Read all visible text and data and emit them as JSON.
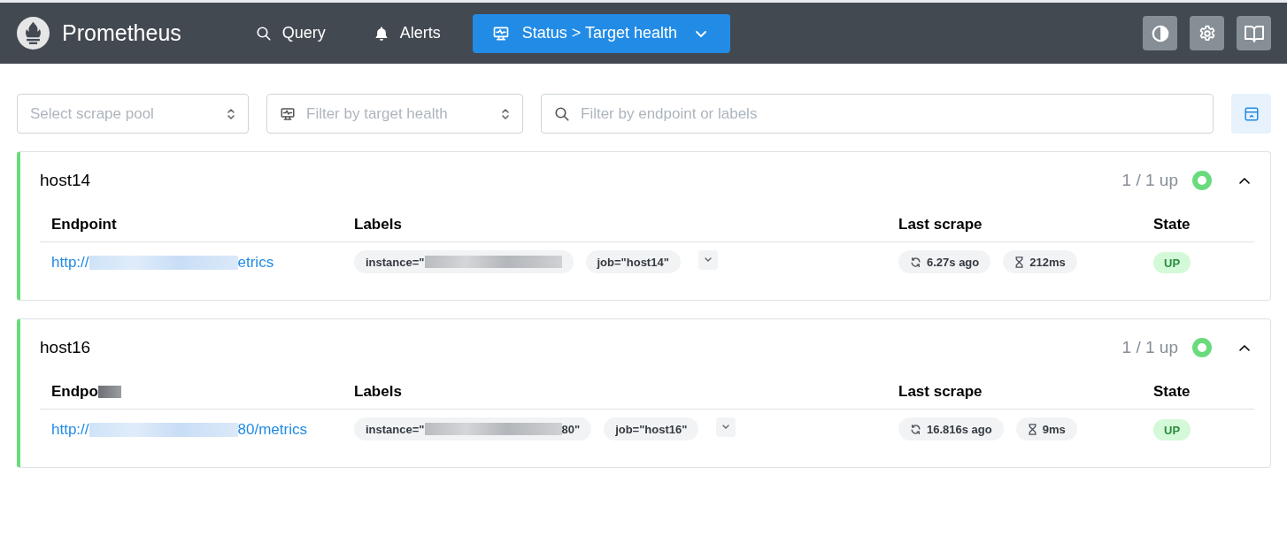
{
  "nav": {
    "brand": "Prometheus",
    "items": [
      {
        "label": "Query",
        "kind": "query",
        "selected": false
      },
      {
        "label": "Alerts",
        "kind": "alerts",
        "selected": false
      },
      {
        "label": "Status > Target health",
        "kind": "status",
        "selected": true
      }
    ],
    "actions": [
      {
        "kind": "theme"
      },
      {
        "kind": "settings"
      },
      {
        "kind": "docs"
      }
    ]
  },
  "filters": [
    {
      "placeholder": "Select scrape pool",
      "kind": "select"
    },
    {
      "placeholder": "Filter by target health",
      "kind": "health"
    },
    {
      "placeholder": "Filter by endpoint or labels",
      "kind": "search"
    }
  ],
  "pools": [
    {
      "name": "host14",
      "summary": "1 / 1 up",
      "color": "#69db7c",
      "expanded": true,
      "columns": [
        {
          "label": "Endpoint",
          "redacted": false
        },
        {
          "label": "Labels",
          "redacted": false
        },
        {
          "label": "Last scrape",
          "redacted": false
        },
        {
          "label": "State",
          "redacted": false
        }
      ],
      "targets": [
        {
          "endpoint": {
            "start": "http://",
            "end": "etrics",
            "redacted": true
          },
          "labels": [
            {
              "start": "instance=\"",
              "redacted": true
            },
            {
              "start": "job=\"host14\"",
              "redacted": false
            }
          ],
          "last_scrape": "6.27s ago",
          "duration": "212ms",
          "state": "UP",
          "kind": "up"
        }
      ]
    },
    {
      "name": "host16",
      "summary": "1 / 1 up",
      "color": "#69db7c",
      "expanded": true,
      "columns": [
        {
          "label": "Endpo",
          "redacted": true
        },
        {
          "label": "Labels",
          "redacted": false
        },
        {
          "label": "Last scrape",
          "redacted": false
        },
        {
          "label": "State",
          "redacted": false
        }
      ],
      "targets": [
        {
          "endpoint": {
            "start": "http://",
            "end": "80/metrics",
            "redacted": true
          },
          "labels": [
            {
              "start": "instance=\"",
              "end": "80\"",
              "redacted": true
            },
            {
              "start": "job=\"host16\"",
              "redacted": false
            }
          ],
          "last_scrape": "16.816s ago",
          "duration": "9ms",
          "state": "UP",
          "kind": "up"
        }
      ]
    }
  ]
}
